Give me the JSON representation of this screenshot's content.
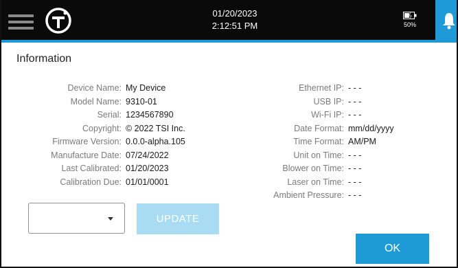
{
  "colors": {
    "topbar_bg": "#0a0a0a",
    "accent": "#1e9bd7",
    "update_disabled": "#a9dcf3",
    "label_gray": "#7a7a7a"
  },
  "header": {
    "menu_icon": "hamburger-menu-icon",
    "logo_icon": "tsi-logo-icon",
    "date": "01/20/2023",
    "time": "2:12:51 PM",
    "battery_icon": "battery-charging-icon",
    "battery_level": "50%",
    "notification_icon": "bell-icon"
  },
  "page": {
    "title": "Information"
  },
  "info_left": [
    {
      "label": "Device Name:",
      "value": "My Device"
    },
    {
      "label": "Model Name:",
      "value": "9310-01"
    },
    {
      "label": "Serial:",
      "value": "1234567890"
    },
    {
      "label": "Copyright:",
      "value": "© 2022 TSI Inc."
    },
    {
      "label": "Firmware Version:",
      "value": "0.0.0-alpha.105"
    },
    {
      "label": "Manufacture Date:",
      "value": "07/24/2022"
    },
    {
      "label": "Last Calibrated:",
      "value": "01/20/2023"
    },
    {
      "label": "Calibration Due:",
      "value": "01/01/0001"
    }
  ],
  "info_right": [
    {
      "label": "Ethernet IP:",
      "value": "- - -"
    },
    {
      "label": "USB IP:",
      "value": "- - -"
    },
    {
      "label": "Wi-Fi IP:",
      "value": "- - -"
    },
    {
      "label": "Date Format:",
      "value": "mm/dd/yyyy"
    },
    {
      "label": "Time Format:",
      "value": "AM/PM"
    },
    {
      "label": "Unit on Time:",
      "value": "- - -"
    },
    {
      "label": "Blower on Time:",
      "value": "- - -"
    },
    {
      "label": "Laser on Time:",
      "value": "- - -"
    },
    {
      "label": "Ambient Pressure:",
      "value": "- - -"
    }
  ],
  "controls": {
    "dropdown_value": "",
    "dropdown_icon": "caret-down-icon",
    "update_label": "UPDATE",
    "ok_label": "OK"
  }
}
